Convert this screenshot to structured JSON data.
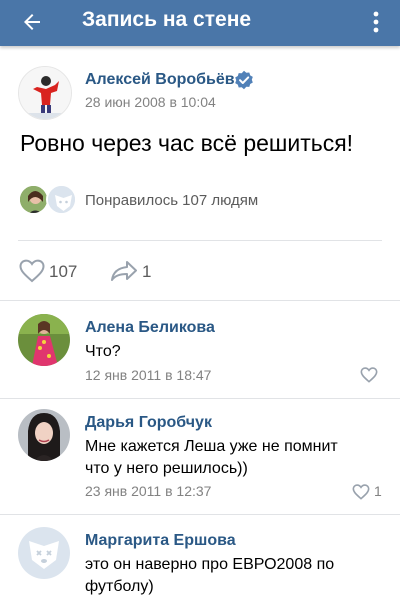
{
  "header": {
    "title": "Запись на стене",
    "back_icon": "arrow-left-icon",
    "menu_icon": "more-vertical-icon",
    "bg_color": "#4a76a8"
  },
  "post": {
    "author": "Алексей Воробьёв",
    "verified_icon": "verified-check-icon",
    "date": "28 июн 2008 в 10:04",
    "text": "Ровно через час всё решиться!",
    "liked_by_text": "Понравилось 107 людям",
    "likes": "107",
    "shares": "1"
  },
  "comments": [
    {
      "author": "Алена Беликова",
      "lines": [
        "Что?"
      ],
      "date": "12 янв 2011 в 18:47",
      "likes": ""
    },
    {
      "author": "Дарья Горобчук",
      "lines": [
        "Мне кажется Леша уже не помнит",
        "что у него решилось))"
      ],
      "date": "23 янв 2011 в 12:37",
      "likes": "1"
    },
    {
      "author": "Маргарита Ершова",
      "lines": [
        "это он наверно про ЕВРО2008 по",
        "футболу)"
      ],
      "date": "",
      "likes": ""
    }
  ],
  "colors": {
    "link": "#2a5885",
    "muted": "#828282",
    "icon": "#99a2ad"
  }
}
